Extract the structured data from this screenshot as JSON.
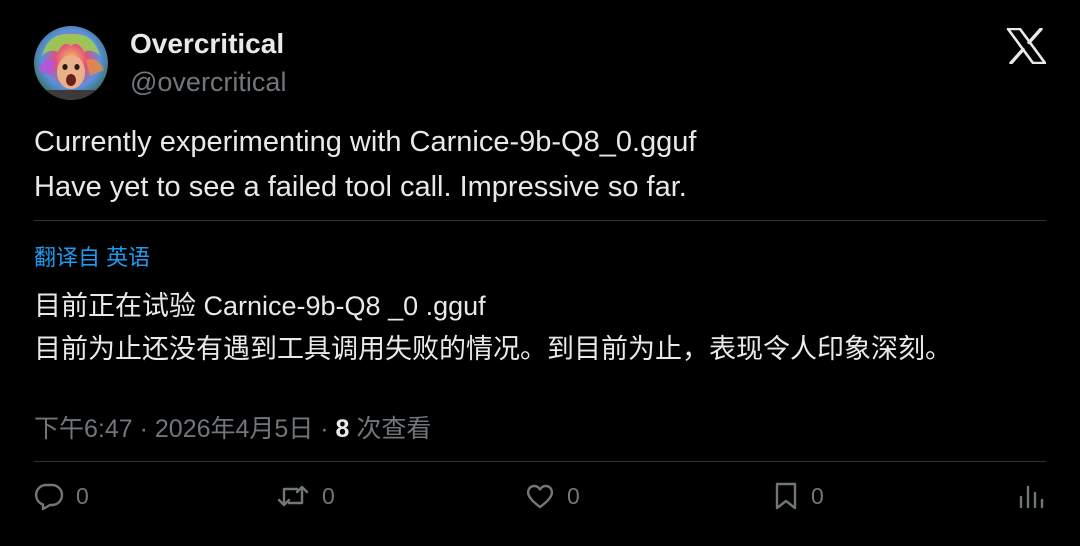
{
  "author": {
    "display_name": "Overcritical",
    "handle": "@overcritical"
  },
  "post": {
    "lines": [
      "Currently experimenting with Carnice-9b-Q8_0.gguf",
      "Have yet to see a failed tool call. Impressive so far."
    ]
  },
  "translation": {
    "label": "翻译自 英语",
    "lines": [
      "目前正在试验 Carnice-9b-Q8 _0 .gguf",
      "目前为止还没有遇到工具调用失败的情况。到目前为止，表现令人印象深刻。"
    ]
  },
  "meta": {
    "time": "下午6:47",
    "separator": " · ",
    "date": "2026年4月5日",
    "views_count": "8",
    "views_label": " 次查看"
  },
  "actions": {
    "reply_count": "0",
    "retweet_count": "0",
    "like_count": "0",
    "bookmark_count": "0"
  },
  "colors": {
    "background": "#000000",
    "primary_text": "#e7e9ea",
    "secondary_text": "#71767b",
    "link": "#1d9bf0",
    "divider": "#2f3336"
  },
  "icons": [
    "x-logo-icon",
    "reply-icon",
    "retweet-icon",
    "like-icon",
    "bookmark-icon",
    "analytics-icon"
  ]
}
